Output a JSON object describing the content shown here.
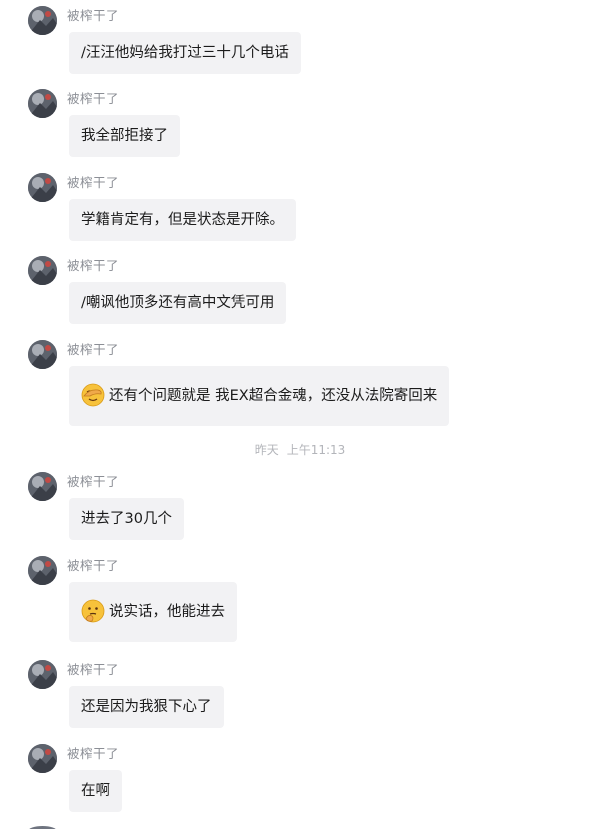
{
  "sender_name": "被榨干了",
  "timestamp": {
    "day": "昨天",
    "time": "上午11:13"
  },
  "messages": [
    {
      "text": "/汪汪他妈给我打过三十几个电话",
      "emoji": null
    },
    {
      "text": "我全部拒接了",
      "emoji": null
    },
    {
      "text": "学籍肯定有，但是状态是开除。",
      "emoji": null
    },
    {
      "text": "/嘲讽他顶多还有高中文凭可用",
      "emoji": null
    },
    {
      "text": "还有个问题就是 我EX超合金魂，还没从法院寄回来",
      "emoji": "facepalm-emoji"
    },
    {
      "text": "进去了30几个",
      "emoji": null
    },
    {
      "text": "说实话，他能进去",
      "emoji": "thinking-emoji"
    },
    {
      "text": "还是因为我狠下心了",
      "emoji": null
    },
    {
      "text": "在啊",
      "emoji": null
    }
  ],
  "colors": {
    "bubble": "#f2f2f4",
    "sender": "#8c8f96",
    "timestamp": "#b3b5ba",
    "emoji_face": "#f7c23b"
  }
}
